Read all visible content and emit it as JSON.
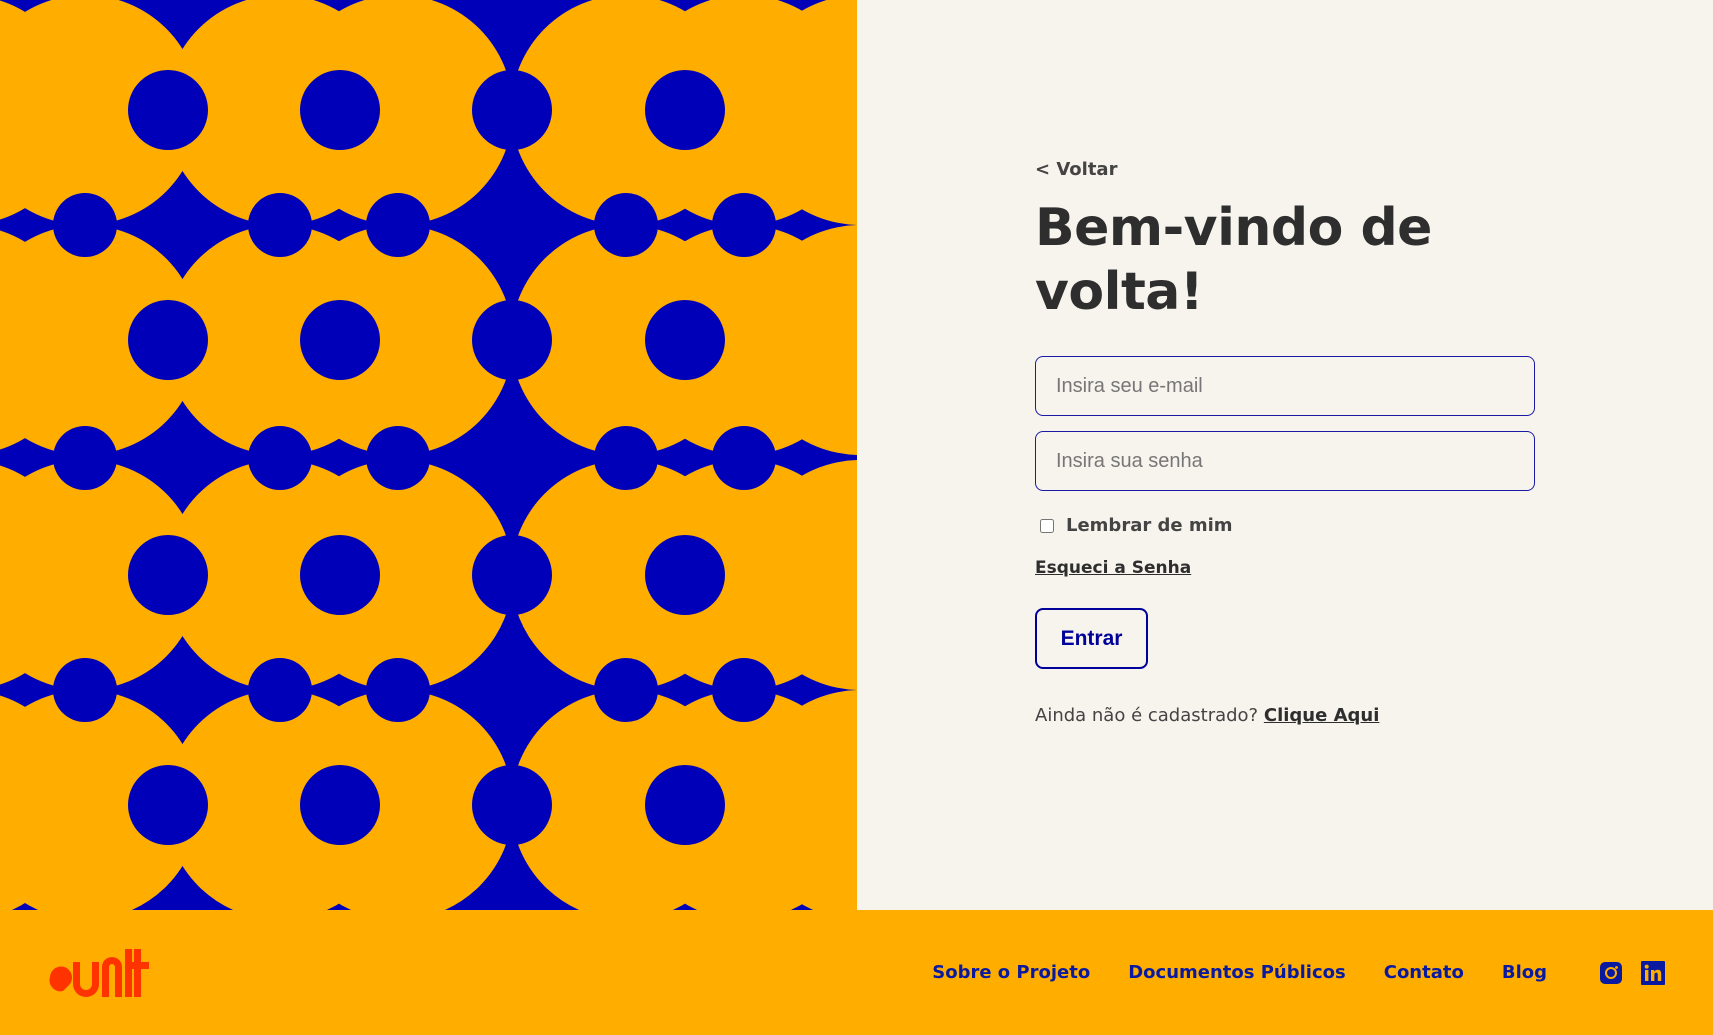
{
  "colors": {
    "pattern_blue": "#0000b8",
    "pattern_yellow": "#ffae00",
    "page_bg": "#f7f3ed",
    "footer_bg": "#ffae00",
    "accent_blue": "#0a1aa0",
    "logo_red": "#ff3300"
  },
  "login": {
    "back_label": "< Voltar",
    "title": "Bem-vindo de volta!",
    "email_placeholder": "Insira seu e-mail",
    "password_placeholder": "Insira sua senha",
    "remember_label": "Lembrar de mim",
    "forgot_label": "Esqueci a Senha",
    "submit_label": "Entrar",
    "signup_prompt": "Ainda não é cadastrado?",
    "signup_link": "Clique Aqui"
  },
  "footer": {
    "logo_icon": "brand-logo-icon",
    "nav": [
      {
        "label": "Sobre o Projeto"
      },
      {
        "label": "Documentos Públicos"
      },
      {
        "label": "Contato"
      },
      {
        "label": "Blog"
      }
    ],
    "social": [
      "instagram-icon",
      "linkedin-icon"
    ]
  }
}
